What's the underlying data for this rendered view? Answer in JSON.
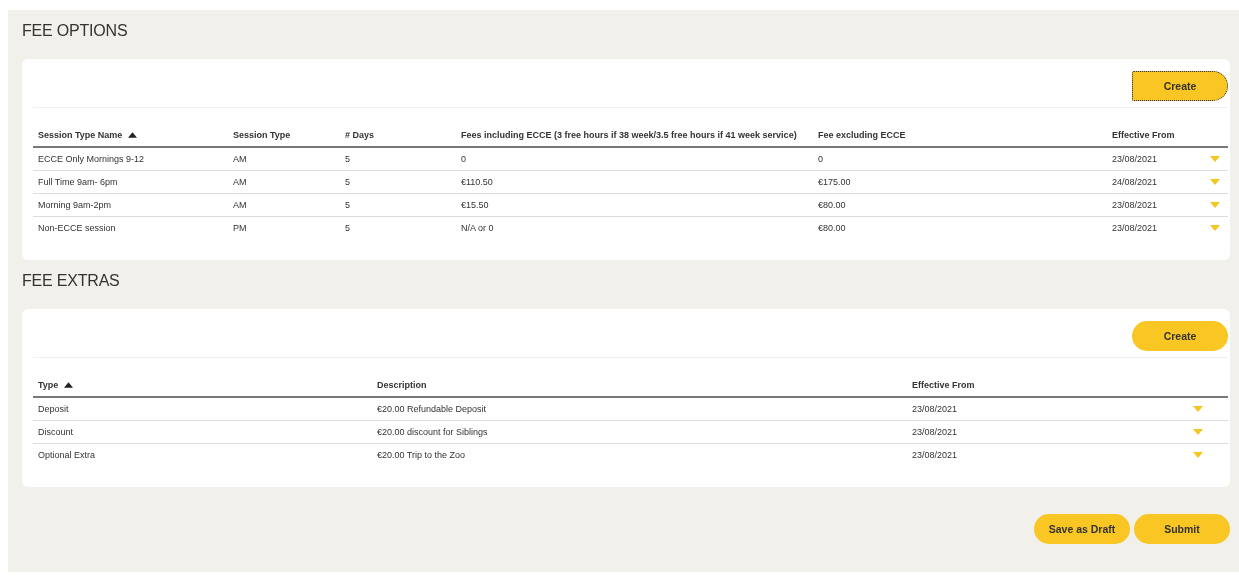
{
  "sections": [
    {
      "title": "FEE OPTIONS",
      "create": {
        "label": "Create",
        "focused": true
      },
      "columns": [
        {
          "label": "Session Type Name",
          "sorted": true
        },
        {
          "label": "Session Type",
          "sorted": false
        },
        {
          "label": "# Days",
          "sorted": false
        },
        {
          "label": "Fees including ECCE (3 free hours if 38 week/3.5 free hours if 41 week service)",
          "sorted": false
        },
        {
          "label": "Fee excluding ECCE",
          "sorted": false
        },
        {
          "label": "Effective From",
          "sorted": false
        }
      ],
      "rows": [
        [
          "ECCE Only Mornings 9-12",
          "AM",
          "5",
          "0",
          "0",
          "23/08/2021"
        ],
        [
          "Full Time 9am- 6pm",
          "AM",
          "5",
          "€110.50",
          "€175.00",
          "24/08/2021"
        ],
        [
          "Morning 9am-2pm",
          "AM",
          "5",
          "€15.50",
          "€80.00",
          "23/08/2021"
        ],
        [
          "Non-ECCE session",
          "PM",
          "5",
          "N/A or 0",
          "€80.00",
          "23/08/2021"
        ]
      ]
    },
    {
      "title": "FEE EXTRAS",
      "create": {
        "label": "Create",
        "focused": false
      },
      "columns": [
        {
          "label": "Type",
          "sorted": true
        },
        {
          "label": "Description",
          "sorted": false
        },
        {
          "label": "Effective From",
          "sorted": false
        }
      ],
      "rows": [
        [
          "Deposit",
          "€20.00 Refundable Deposit",
          "23/08/2021"
        ],
        [
          "Discount",
          "€20.00 discount for Siblings",
          "23/08/2021"
        ],
        [
          "Optional Extra",
          "€20.00 Trip to the Zoo",
          "23/08/2021"
        ]
      ]
    }
  ],
  "actions": [
    {
      "label": "Save as Draft"
    },
    {
      "label": "Submit"
    }
  ]
}
